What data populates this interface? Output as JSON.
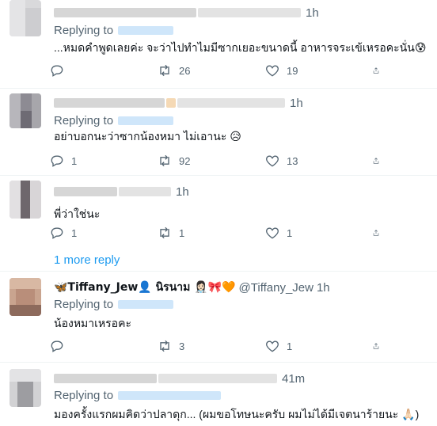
{
  "tweets": [
    {
      "time": "1h",
      "replying_label": "Replying to",
      "text": "...หมดคำพูดเลยค่ะ จะว่าไปทำไมมีซากเยอะขนาดนี้ อาหารจระเข้เหรอคะนั่น😰",
      "replies": "",
      "retweets": "26",
      "likes": "19"
    },
    {
      "time": "1h",
      "replying_label": "Replying to",
      "text": "อย่าบอกนะว่าซากน้องหมา ไม่เอานะ 😥",
      "replies": "1",
      "retweets": "92",
      "likes": "13"
    },
    {
      "time": "1h",
      "replying_label": "",
      "text": "พี่ว่าใช่นะ",
      "replies": "1",
      "retweets": "1",
      "likes": "1"
    },
    {
      "name": "🦋Tiffany_Jew👤 นิรนาม 👩🏻‍⚕️🎀🧡",
      "handle": "@Tiffany_Jew",
      "time": "1h",
      "replying_label": "Replying to",
      "text": "น้องหมาเหรอคะ",
      "replies": "",
      "retweets": "3",
      "likes": "1"
    },
    {
      "time": "41m",
      "replying_label": "Replying to",
      "text": "มองครั้งแรกผมคิดว่าปลาดุก... (ผมขอโทษนะครับ ผมไม่ได้มีเจตนาร้ายนะ 🙏🏻)"
    }
  ],
  "more_replies": "1 more reply",
  "icons": {
    "reply": "reply-icon",
    "retweet": "retweet-icon",
    "like": "heart-icon",
    "share": "share-icon"
  },
  "colors": {
    "link": "#1d9bf0",
    "secondary_text": "#536471",
    "divider": "#eff3f4"
  }
}
